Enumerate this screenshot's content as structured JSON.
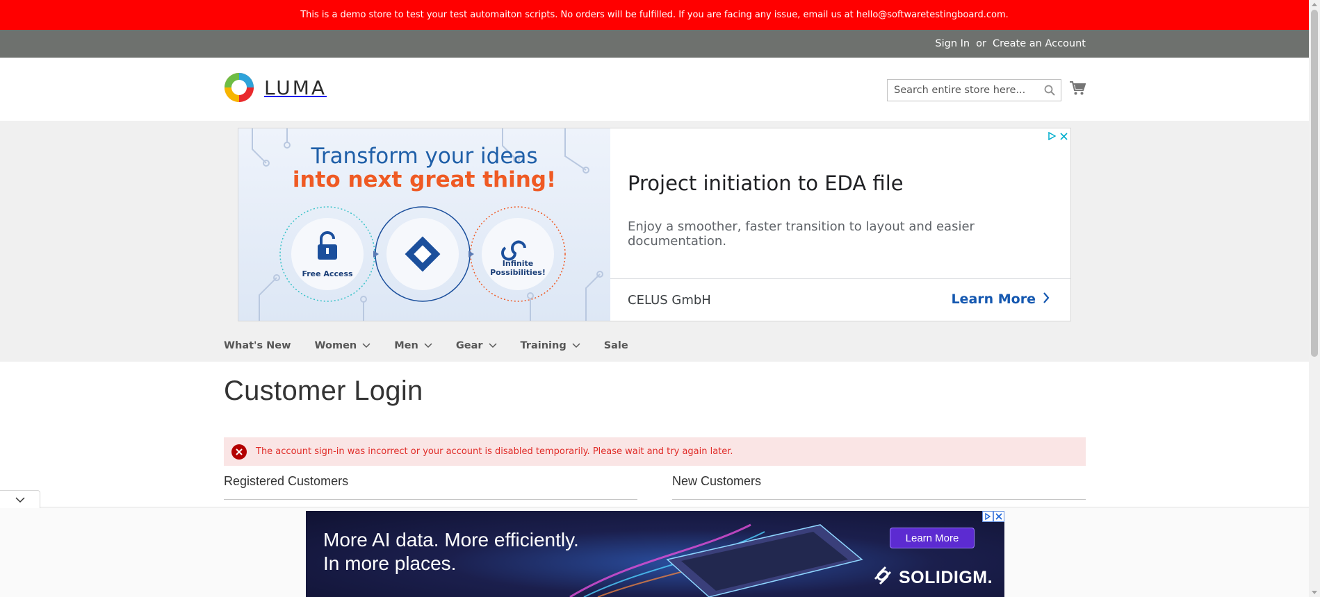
{
  "demo_banner": {
    "text": "This is a demo store to test your test automaiton scripts. No orders will be fulfilled. If you are facing any issue, email us at hello@softwaretestingboard.com."
  },
  "header": {
    "sign_in": "Sign In",
    "or": "or",
    "create_account": "Create an Account",
    "logo_text": "LUMA",
    "search_placeholder": "Search entire store here..."
  },
  "top_ad": {
    "headline_line1": "Transform your ideas",
    "headline_line2": "into next great thing!",
    "circle_1_label": "Free Access",
    "circle_3_label_line1": "Infinite",
    "circle_3_label_line2": "Possibilities!",
    "title": "Project initiation to EDA file",
    "description": "Enjoy a smoother, faster transition to layout and easier documentation.",
    "advertiser": "CELUS GmbH",
    "cta": "Learn More"
  },
  "nav": {
    "items": [
      {
        "label": "What's New",
        "has_dropdown": false
      },
      {
        "label": "Women",
        "has_dropdown": true
      },
      {
        "label": "Men",
        "has_dropdown": true
      },
      {
        "label": "Gear",
        "has_dropdown": true
      },
      {
        "label": "Training",
        "has_dropdown": true
      },
      {
        "label": "Sale",
        "has_dropdown": false
      }
    ]
  },
  "main": {
    "page_title": "Customer Login",
    "error_message": "The account sign-in was incorrect or your account is disabled temporarily. Please wait and try again later.",
    "registered_title": "Registered Customers",
    "new_title": "New Customers"
  },
  "bottom_ad": {
    "line1": "More AI data. More efficiently.",
    "line2": "In more places.",
    "cta": "Learn More",
    "brand": "SOLIDIGM."
  },
  "colors": {
    "demo_banner_bg": "#ff0000",
    "header_panel_bg": "#6e716e",
    "error_bg": "#fae5e5",
    "error_text": "#e02b27",
    "ad_link": "#1558b0"
  },
  "icons": [
    "search-icon",
    "cart-icon",
    "chevron-down-icon",
    "error-icon",
    "chevron-right-icon",
    "ad-choices-icon",
    "close-icon",
    "collapse-chevron-icon"
  ]
}
